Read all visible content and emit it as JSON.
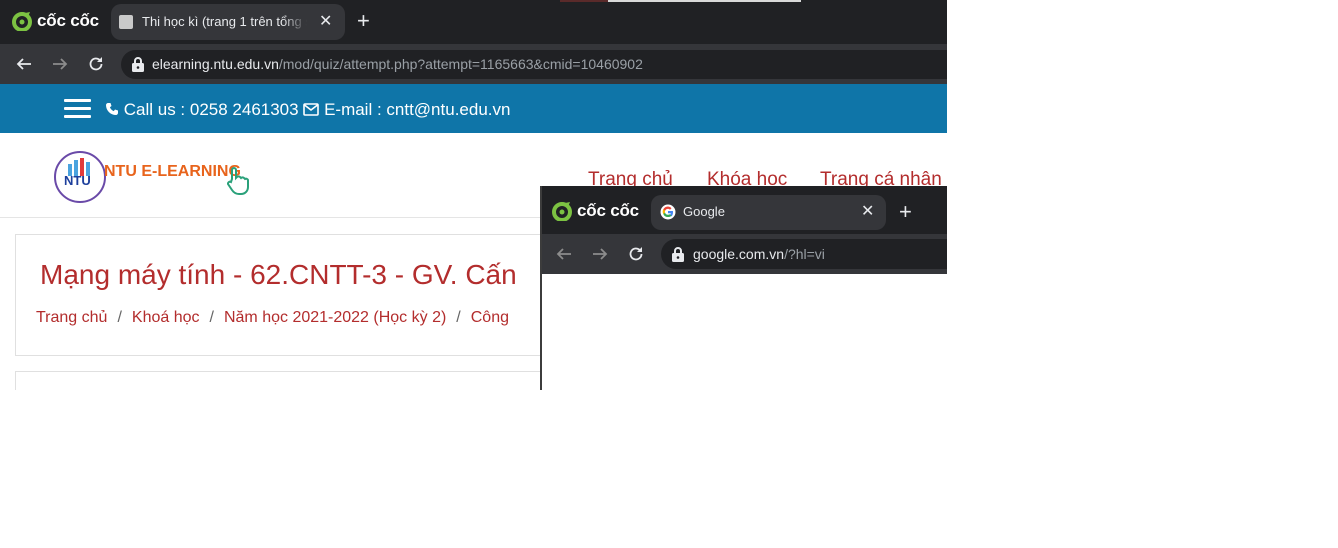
{
  "browser_main": {
    "brand": "cốc cốc",
    "tab": {
      "title": "Thi học kì (trang 1 trên tổng số"
    },
    "url": {
      "host": "elearning.ntu.edu.vn",
      "path": "/mod/quiz/attempt.php?attempt=1165663&cmid=10460902"
    }
  },
  "page": {
    "contact": {
      "phone_label": "Call us : 0258 2461303",
      "email_label": "E-mail : cntt@ntu.edu.vn"
    },
    "logo": {
      "short": "NTU",
      "name": "NTU E-LEARNING"
    },
    "nav": [
      "Trang chủ",
      "Khóa học",
      "Trang cá nhân"
    ],
    "course_title": "Mạng máy tính - 62.CNTT-3 - GV. Cấn",
    "breadcrumb": [
      "Trang chủ",
      "Khoá học",
      "Năm học 2021-2022 (Học kỳ 2)",
      "Công"
    ]
  },
  "browser_overlay": {
    "brand": "cốc cốc",
    "tab": {
      "title": "Google"
    },
    "url": {
      "host": "google.com.vn",
      "path": "/?hl=vi"
    }
  },
  "colors": {
    "chrome_dark": "#202124",
    "chrome_toolbar": "#35363a",
    "topbar_blue": "#0f75a8",
    "link_red": "#b32d2d",
    "logo_orange": "#e8641c",
    "coccoc_green": "#7cc242"
  }
}
